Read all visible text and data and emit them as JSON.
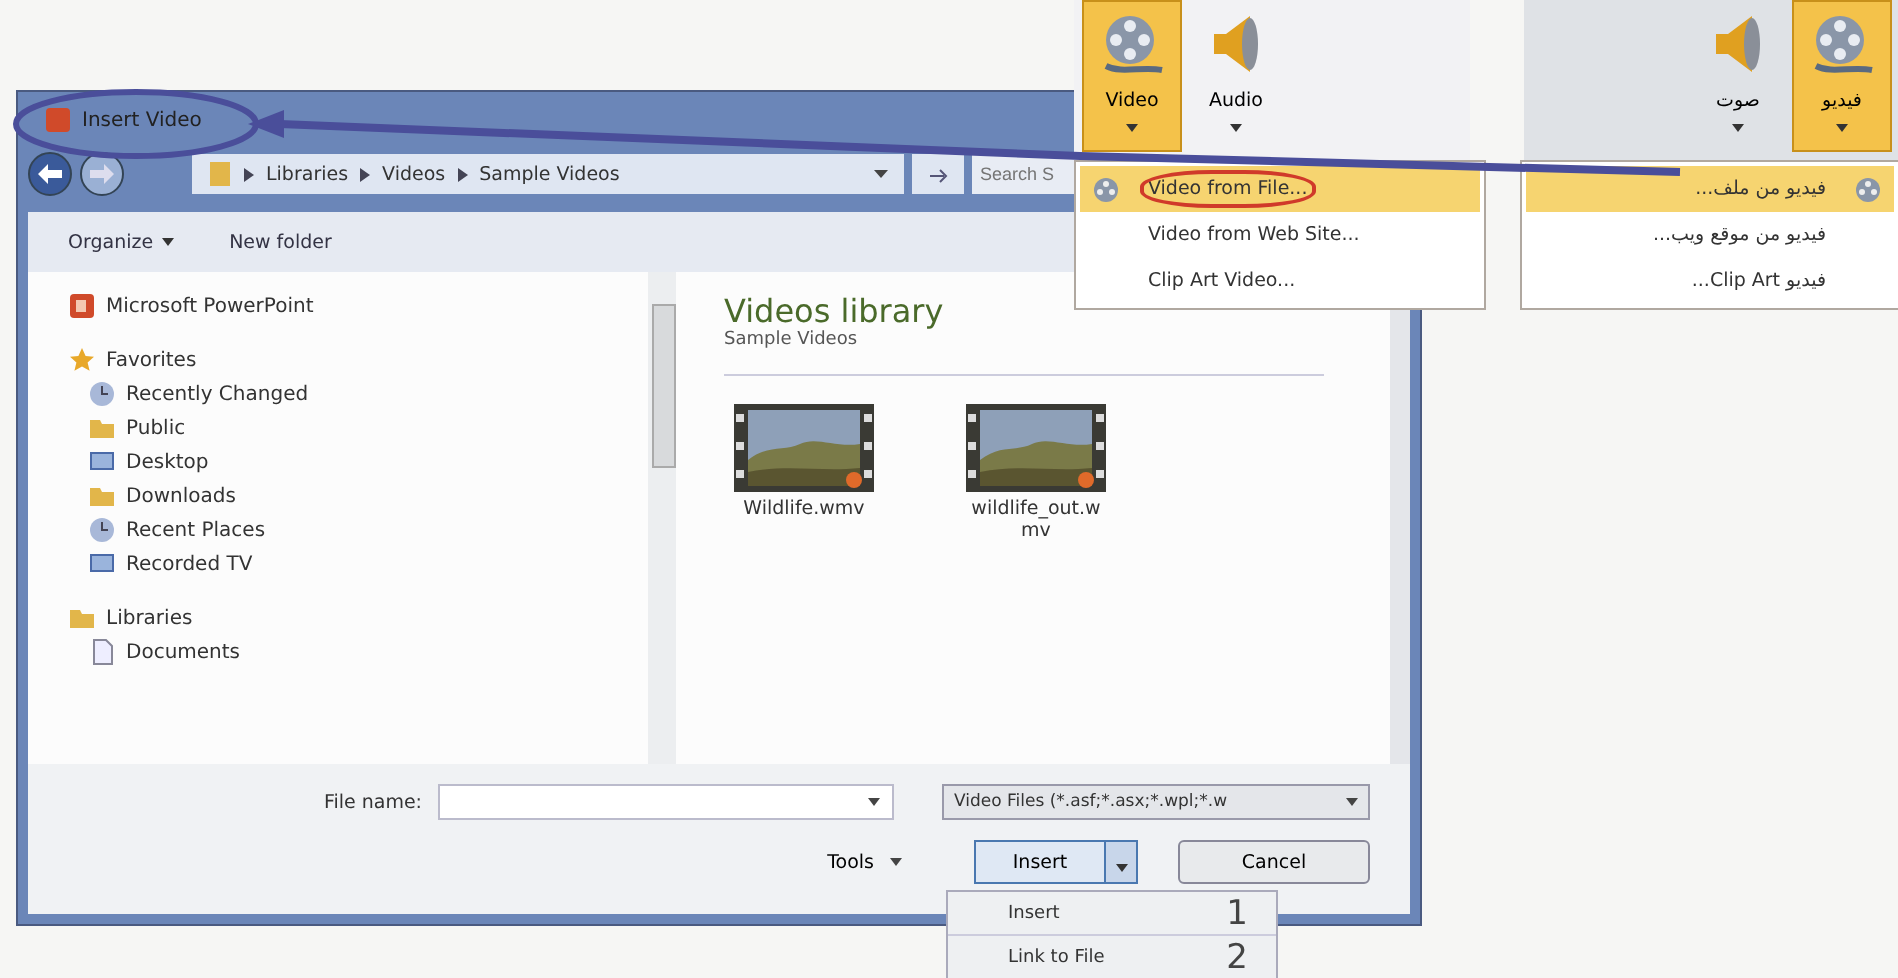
{
  "dialog": {
    "title": "Insert Video",
    "breadcrumb": [
      "Libraries",
      "Videos",
      "Sample Videos"
    ],
    "search": {
      "placeholder": "Search S"
    },
    "toolbar": [
      {
        "label": "Organize",
        "dropdown": true
      },
      {
        "label": "New folder",
        "dropdown": false
      }
    ],
    "nav": [
      {
        "label": "Microsoft PowerPoint",
        "kind": "app"
      },
      {
        "label": "Favorites",
        "kind": "star",
        "children": [
          {
            "label": "Recently Changed",
            "kind": "recent"
          },
          {
            "label": "Public",
            "kind": "folder"
          },
          {
            "label": "Desktop",
            "kind": "desktop"
          },
          {
            "label": "Downloads",
            "kind": "folder"
          },
          {
            "label": "Recent Places",
            "kind": "recent"
          },
          {
            "label": "Recorded TV",
            "kind": "desktop"
          }
        ]
      },
      {
        "label": "Libraries",
        "kind": "folder",
        "children": [
          {
            "label": "Documents",
            "kind": "doc"
          }
        ]
      }
    ],
    "library": {
      "title": "Videos library",
      "subtitle": "Sample Videos"
    },
    "files": [
      {
        "name": "Wildlife.wmv"
      },
      {
        "name": "wildlife_out.wmv"
      }
    ],
    "file_name_label": "File name:",
    "file_type": "Video Files (*.asf;*.asx;*.wpl;*.w",
    "tools": "Tools",
    "insert": "Insert",
    "cancel": "Cancel"
  },
  "insert_menu": [
    {
      "label": "Insert",
      "number": "1"
    },
    {
      "label": "Link to File",
      "number": "2"
    }
  ],
  "ribbon_en": {
    "buttons": [
      {
        "label": "Video",
        "kind": "video",
        "selected": true
      },
      {
        "label": "Audio",
        "kind": "audio",
        "selected": false
      }
    ],
    "menu": [
      {
        "label": "Video from File...",
        "selected": true,
        "circled": true
      },
      {
        "label": "Video from Web Site...",
        "selected": false,
        "circled": false
      },
      {
        "label": "Clip Art Video...",
        "selected": false,
        "circled": false
      }
    ]
  },
  "ribbon_ar": {
    "buttons": [
      {
        "label": "فيديو",
        "kind": "video",
        "selected": true
      },
      {
        "label": "صوت",
        "kind": "audio",
        "selected": false
      }
    ],
    "menu": [
      {
        "label": "فيديو من ملف...",
        "selected": true,
        "circled": false
      },
      {
        "label": "فيديو من موقع ويب...",
        "selected": false,
        "circled": false
      },
      {
        "label": "فيديو Clip Art...",
        "selected": false,
        "circled": false
      }
    ]
  }
}
